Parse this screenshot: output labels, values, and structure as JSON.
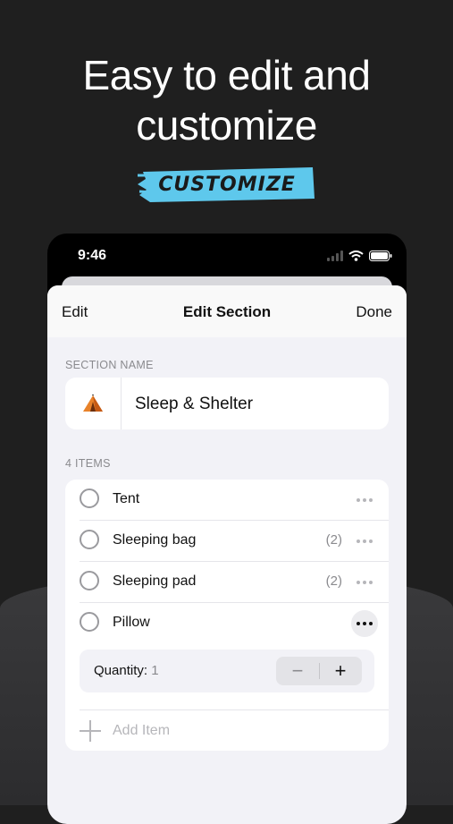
{
  "hero": {
    "line1": "Easy to edit and",
    "line2": "customize",
    "badge": "CUSTOMIZE"
  },
  "colors": {
    "badge_bg": "#5ec8ec",
    "background": "#1f1f1f",
    "sheet_bg": "#f2f2f7"
  },
  "status_bar": {
    "time": "9:46",
    "icons": [
      "signal-icon",
      "wifi-icon",
      "battery-icon"
    ]
  },
  "nav": {
    "left": "Edit",
    "title": "Edit Section",
    "right": "Done"
  },
  "section": {
    "caption": "SECTION NAME",
    "emoji_icon": "tent-icon",
    "name": "Sleep & Shelter"
  },
  "items": {
    "caption": "4 ITEMS",
    "list": [
      {
        "label": "Tent",
        "count": ""
      },
      {
        "label": "Sleeping bag",
        "count": "(2)"
      },
      {
        "label": "Sleeping pad",
        "count": "(2)"
      },
      {
        "label": "Pillow",
        "count": ""
      }
    ],
    "quantity_label": "Quantity:",
    "quantity_value": "1",
    "add_placeholder": "Add Item"
  }
}
